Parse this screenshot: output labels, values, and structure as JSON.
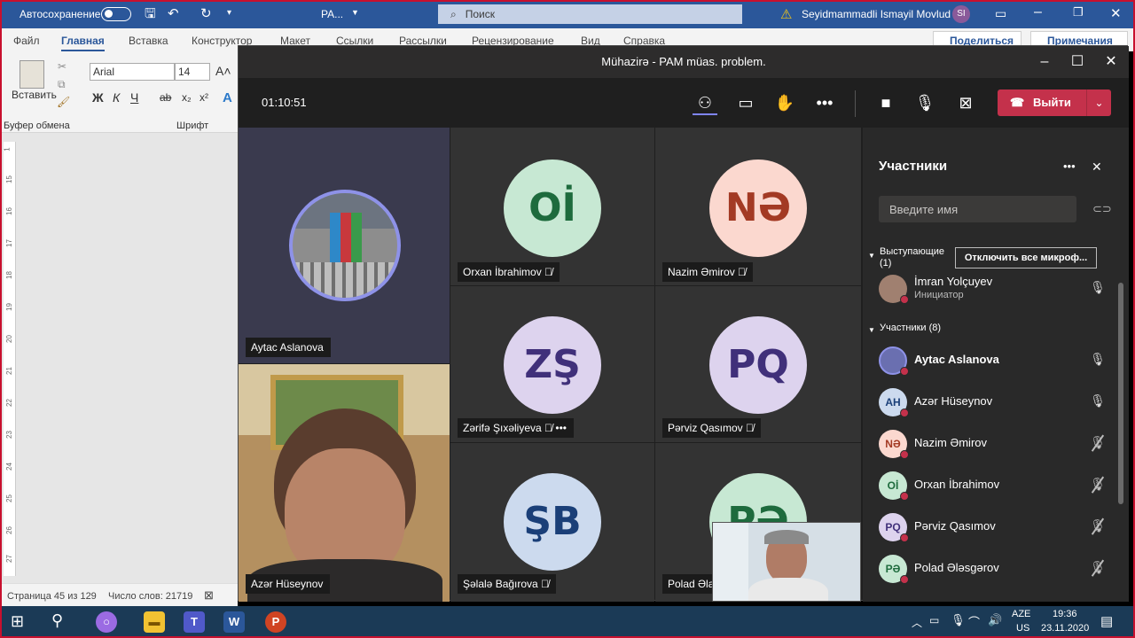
{
  "word": {
    "autosave": "Автосохранение",
    "doc_title": "PA...",
    "search": "Поиск",
    "user": "Seyidmammadli Ismayil Movlud",
    "user_initials": "SI",
    "menu": [
      "Файл",
      "Главная",
      "Вставка",
      "Конструктор",
      "Макет",
      "Ссылки",
      "Рассылки",
      "Рецензирование",
      "Вид",
      "Справка"
    ],
    "share": "Поделиться",
    "comments": "Примечания",
    "paste": "Вставить",
    "clipboard": "Буфер обмена",
    "font_group": "Шрифт",
    "font_name": "Arial",
    "font_size": "14",
    "ruler": [
      "1",
      "15",
      "16",
      "17",
      "18",
      "19",
      "20",
      "21",
      "22",
      "23",
      "24",
      "25",
      "26",
      "27"
    ],
    "status_page": "Страница 45 из 129",
    "status_words": "Число слов: 21719"
  },
  "teams": {
    "title": "Mühazirə - PAM müas. problem.",
    "timer": "01:10:51",
    "leave": "Выйти",
    "tiles": [
      {
        "name": "Aytac Aslanova",
        "type": "photo"
      },
      {
        "name": "Orxan İbrahimov",
        "initials": "Oİ",
        "bg": "#c7e8d3",
        "fg": "#1e6b3d",
        "muted": true
      },
      {
        "name": "Nazim Əmirov",
        "initials": "NƏ",
        "bg": "#fbd8cf",
        "fg": "#a33a24",
        "muted": true
      },
      {
        "name": "Azər Hüseynov",
        "type": "video"
      },
      {
        "name": "Zərifə Şıxəliyeva",
        "initials": "ZŞ",
        "bg": "#ddd3ee",
        "fg": "#40307a",
        "muted": true
      },
      {
        "name": "Pərviz Qasımov",
        "initials": "PQ",
        "bg": "#ddd3ee",
        "fg": "#40307a",
        "muted": true
      },
      {
        "name": "Şəlalə Bağırova",
        "initials": "ŞB",
        "bg": "#ccdaee",
        "fg": "#1a3f78",
        "muted": true
      },
      {
        "name": "Polad Əlasgarov",
        "initials": "PƏ",
        "bg": "#c7e8d3",
        "fg": "#1e6b3d",
        "muted": true
      }
    ],
    "panel": {
      "title": "Участники",
      "search_placeholder": "Введите имя",
      "presenters_label": "Выступающие",
      "presenters_count": "(1)",
      "mute_all": "Отключить все микроф...",
      "presenter": {
        "name": "İmran Yolçuyev",
        "role": "Инициатор"
      },
      "attendees_label": "Участники (8)",
      "attendees": [
        {
          "name": "Aytac Aslanova",
          "initials": "",
          "bg": "#6a6fb0",
          "fg": "#fff",
          "mic": "on",
          "bold": true
        },
        {
          "name": "Azər Hüseynov",
          "initials": "AH",
          "bg": "#ccdaee",
          "fg": "#1a3f78",
          "mic": "on"
        },
        {
          "name": "Nazim Əmirov",
          "initials": "NƏ",
          "bg": "#fbd8cf",
          "fg": "#a33a24",
          "mic": "off"
        },
        {
          "name": "Orxan İbrahimov",
          "initials": "Oİ",
          "bg": "#c7e8d3",
          "fg": "#1e6b3d",
          "mic": "off"
        },
        {
          "name": "Pərviz Qasımov",
          "initials": "PQ",
          "bg": "#ddd3ee",
          "fg": "#40307a",
          "mic": "off"
        },
        {
          "name": "Polad Ələsgərov",
          "initials": "PƏ",
          "bg": "#c7e8d3",
          "fg": "#1e6b3d",
          "mic": "off"
        }
      ]
    }
  },
  "taskbar": {
    "lang": "AZE",
    "lang_sub": "US",
    "time": "19:36",
    "date": "23.11.2020"
  }
}
